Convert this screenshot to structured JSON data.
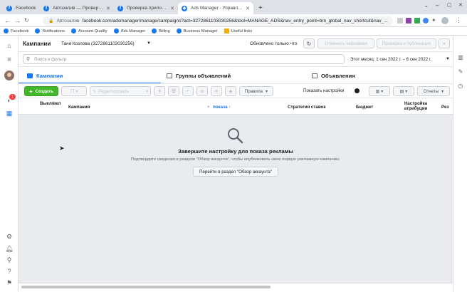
{
  "browser": {
    "tabs": [
      {
        "title": "Facebook",
        "active": false
      },
      {
        "title": "Автозалив — Проверка прил...",
        "active": false
      },
      {
        "title": "Проверка приложения",
        "active": false
      },
      {
        "title": "Ads Manager - Управление ре...",
        "active": true
      }
    ],
    "new_tab": "+",
    "url_site_label": "Автозалив",
    "url": "facebook.com/adsmanager/manage/campaigns?act=3272861103030256&tool=MANAGE_ADS&nav_entry_point=bm_global_nav_shortcut&nav_...",
    "bookmarks": [
      "Facebook",
      "Notifications",
      "Account Quality",
      "Ads Manager",
      "Billing",
      "Business Manager",
      "Useful links"
    ]
  },
  "left_nav": {
    "notification_count": "1"
  },
  "header": {
    "title": "Кампании",
    "account_name": "Таня Козлова (3272861103030256)",
    "updated_text": "Обновлено только что",
    "discard_drafts": "Отменить черновики",
    "review_publish": "Проверка и публикация"
  },
  "search": {
    "placeholder": "Поиск и фильтр",
    "date_range": "Этот месяц: 1 сен 2022 г. – 6 сен 2022 г."
  },
  "level_tabs": [
    {
      "label": "Кампании"
    },
    {
      "label": "Группы объявлений"
    },
    {
      "label": "Объявления"
    }
  ],
  "toolbar": {
    "create": "Создать",
    "edit": "Редактировать",
    "rules": "Правила",
    "view_settings": "Показать настройки",
    "reports": "Отчеты"
  },
  "table": {
    "columns": [
      "Выкл/вкл",
      "Кампания",
      "показа ↑",
      "Стратегия ставок",
      "Бюджет",
      "Настройка атрибуции",
      "Рез"
    ]
  },
  "empty_state": {
    "title": "Завершите настройку для показа рекламы",
    "description": "Подтвердите сведения в разделе \"Обзор аккаунта\", чтобы опубликовать свою первую рекламную кампанию.",
    "button": "Перейти в раздел \"Обзор аккаунта\""
  }
}
